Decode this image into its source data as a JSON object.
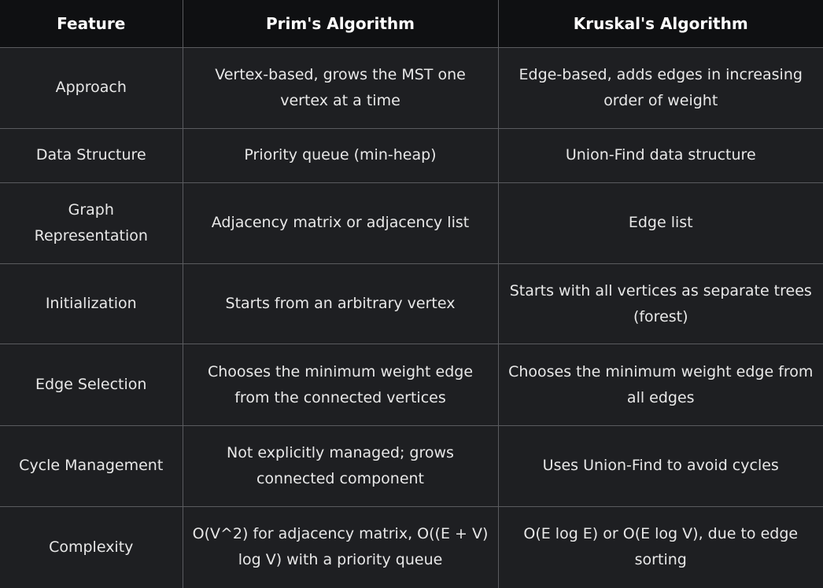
{
  "table": {
    "headers": {
      "feature": "Feature",
      "prim": "Prim's Algorithm",
      "kruskal": "Kruskal's Algorithm"
    },
    "rows": [
      {
        "feature": "Approach",
        "prim": "Vertex-based, grows the MST one vertex at a time",
        "kruskal": "Edge-based, adds edges in increasing order of weight"
      },
      {
        "feature": "Data Structure",
        "prim": "Priority queue (min-heap)",
        "kruskal": "Union-Find data structure"
      },
      {
        "feature": "Graph Representation",
        "prim": "Adjacency matrix or adjacency list",
        "kruskal": "Edge list"
      },
      {
        "feature": "Initialization",
        "prim": "Starts from an arbitrary vertex",
        "kruskal": "Starts with all vertices as separate trees (forest)"
      },
      {
        "feature": "Edge Selection",
        "prim": "Chooses the minimum weight edge from the connected vertices",
        "kruskal": "Chooses the minimum weight edge from all edges"
      },
      {
        "feature": "Cycle Management",
        "prim": "Not explicitly managed; grows connected component",
        "kruskal": "Uses Union-Find to avoid cycles"
      },
      {
        "feature": "Complexity",
        "prim": "O(V^2) for adjacency matrix, O((E + V) log V) with a priority queue",
        "kruskal": "O(E log E) or O(E log V), due to edge sorting"
      }
    ]
  }
}
